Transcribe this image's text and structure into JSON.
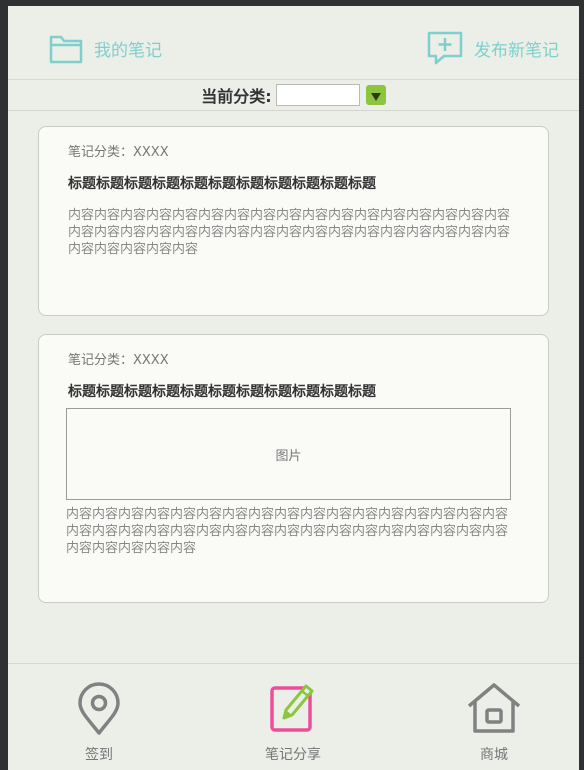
{
  "header": {
    "my_notes_label": "我的笔记",
    "publish_label": "发布新笔记"
  },
  "category_bar": {
    "label": "当前分类:",
    "value": ""
  },
  "notes": [
    {
      "category": "笔记分类：XXXX",
      "title": "标题标题标题标题标题标题标题标题标题标题标题",
      "content": "内容内容内容内容内容内容内容内容内容内容内容内容内容内容内容内容内容内容内容内容内容内容内容内容内容内容内容内容内容内容内容内容内容内容内容内容内容内容内容"
    },
    {
      "category": "笔记分类：XXXX",
      "title": "标题标题标题标题标题标题标题标题标题标题标题",
      "image_label": "图片",
      "content": "内容内容内容内容内容内容内容内容内容内容内容内容内容内容内容内容内容内容内容内容内容内容内容内容内容内容内容内容内容内容内容内容内容内容内容内容内容内容内容"
    }
  ],
  "bottom_nav": {
    "checkin": "签到",
    "share": "笔记分享",
    "mall": "商城"
  },
  "colors": {
    "accent": "#7fd0cc",
    "active": "#ec4f9a",
    "dropdown": "#8cc63f"
  }
}
